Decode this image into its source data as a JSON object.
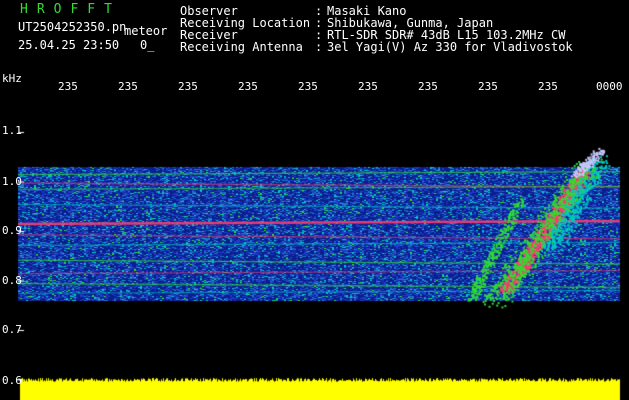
{
  "header": {
    "app_title": "HROFFT",
    "filename": "UT2504252350.pn",
    "event_label": "meteor",
    "datetime": "25.04.25 23:50",
    "count": "0_",
    "fields": [
      {
        "label": "Observer",
        "sep": ":",
        "value": "Masaki Kano"
      },
      {
        "label": "Receiving Location",
        "sep": ":",
        "value": "Shibukawa, Gunma, Japan"
      },
      {
        "label": "Receiver",
        "sep": ":",
        "value": "RTL-SDR SDR# 43dB L15 103.2MHz CW"
      },
      {
        "label": "Receiving Antenna",
        "sep": ":",
        "value": "3el Yagi(V) Az 330 for Vladivostok"
      }
    ]
  },
  "axes": {
    "y_unit": "kHz",
    "y_ticks": [
      "1.1",
      "1.0",
      "0.9",
      "0.8",
      "0.7",
      "0.6"
    ],
    "x_ticks": [
      "235",
      "235",
      "235",
      "235",
      "235",
      "235",
      "235",
      "235",
      "235",
      "0000"
    ]
  },
  "colors": {
    "background": "#000000",
    "noise_blue": "#1e3cc8",
    "noise_cyan": "#00c8c8",
    "signal_green": "#32dc32",
    "signal_red": "#ff3c6e",
    "amplitude_yellow": "#ffff00"
  }
}
